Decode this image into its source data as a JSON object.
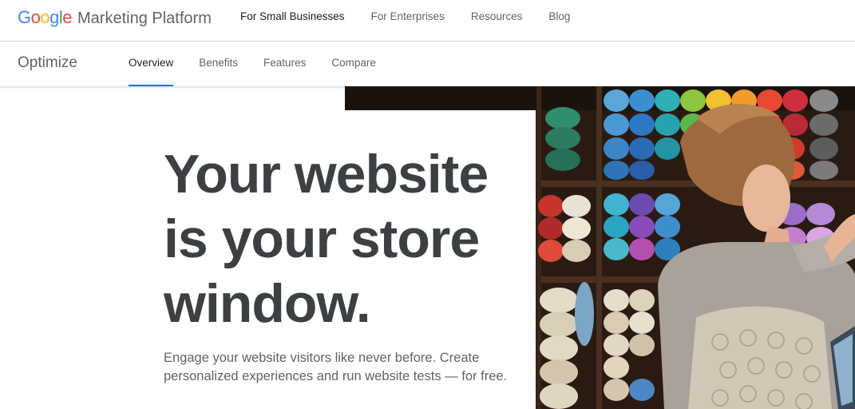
{
  "topbar": {
    "logo_letters": [
      "G",
      "o",
      "o",
      "g",
      "l",
      "e"
    ],
    "brand_name": "Marketing Platform",
    "nav": [
      {
        "label": "For Small Businesses",
        "active": true
      },
      {
        "label": "For Enterprises",
        "active": false
      },
      {
        "label": "Resources",
        "active": false
      },
      {
        "label": "Blog",
        "active": false
      }
    ]
  },
  "subbar": {
    "product_name": "Optimize",
    "tabs": [
      {
        "label": "Overview",
        "active": true
      },
      {
        "label": "Benefits",
        "active": false
      },
      {
        "label": "Features",
        "active": false
      },
      {
        "label": "Compare",
        "active": false
      }
    ]
  },
  "hero": {
    "headline": [
      "Your website",
      "is your store",
      "window."
    ],
    "subtext_lines": [
      "Engage your website visitors like never before. Create",
      "personalized experiences and run website tests — for free."
    ],
    "image_icon": "photo-yarn-shop"
  },
  "colors": {
    "accent": "#1a73e8",
    "google_blue": "#4285f4",
    "google_red": "#ea4335",
    "google_yellow": "#fbbc05",
    "google_green": "#34a853"
  }
}
